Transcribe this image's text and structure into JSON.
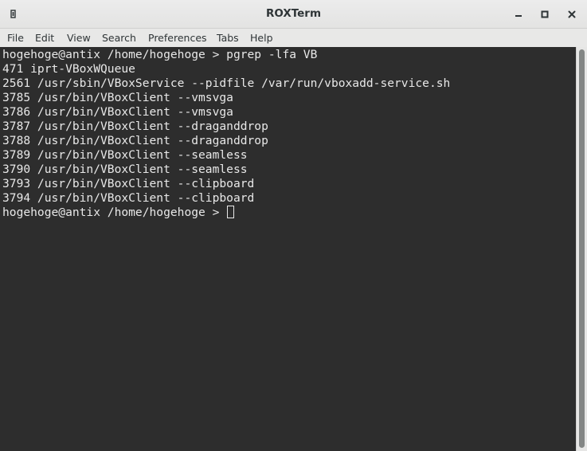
{
  "window": {
    "title": "ROXTerm",
    "icons": {
      "app": "terminal-app-icon",
      "minimize": "minimize-icon",
      "maximize": "maximize-icon",
      "close": "close-icon"
    }
  },
  "menu": {
    "file": "File",
    "edit": "Edit",
    "view": "View",
    "search": "Search",
    "preferences": "Preferences",
    "tabs": "Tabs",
    "help": "Help"
  },
  "terminal": {
    "lines": [
      "hogehoge@antix /home/hogehoge > pgrep -lfa VB",
      "471 iprt-VBoxWQueue",
      "2561 /usr/sbin/VBoxService --pidfile /var/run/vboxadd-service.sh",
      "3785 /usr/bin/VBoxClient --vmsvga",
      "3786 /usr/bin/VBoxClient --vmsvga",
      "3787 /usr/bin/VBoxClient --draganddrop",
      "3788 /usr/bin/VBoxClient --draganddrop",
      "3789 /usr/bin/VBoxClient --seamless",
      "3790 /usr/bin/VBoxClient --seamless",
      "3793 /usr/bin/VBoxClient --clipboard",
      "3794 /usr/bin/VBoxClient --clipboard"
    ],
    "prompt": "hogehoge@antix /home/hogehoge > "
  },
  "colors": {
    "terminal_bg": "#2d2d2d",
    "terminal_fg": "#e8e8e8",
    "chrome_bg": "#e8e8e7"
  }
}
